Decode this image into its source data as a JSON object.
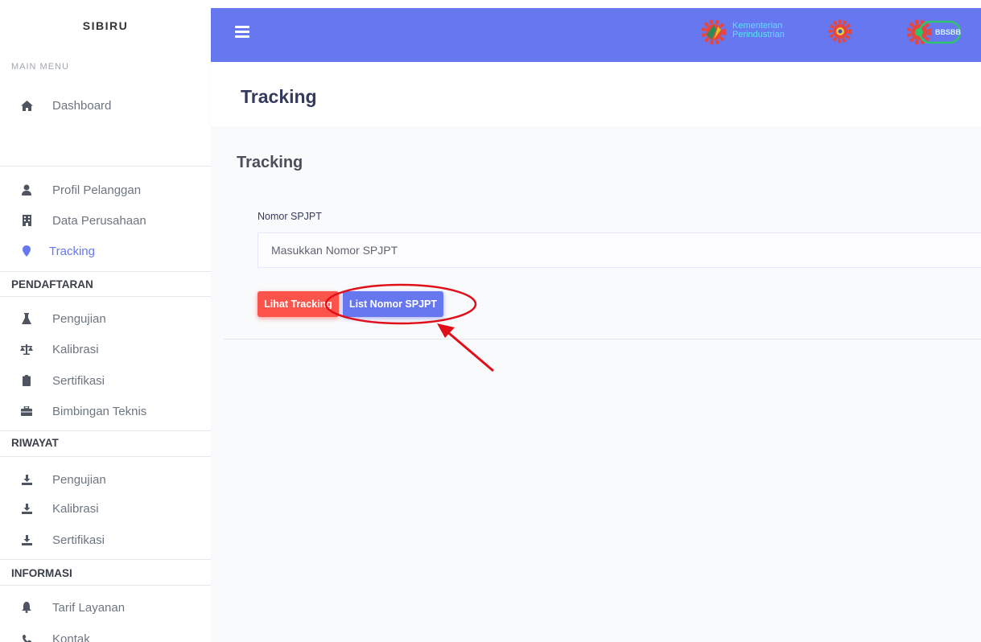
{
  "sidebar": {
    "brand": "SIBIRU",
    "main_menu_heading": "MAIN MENU",
    "dashboard": {
      "label": "Dashboard",
      "icon": "home-icon"
    },
    "items_top": [
      {
        "label": "Profil Pelanggan",
        "icon": "user-icon"
      },
      {
        "label": "Data Perusahaan",
        "icon": "building-icon"
      },
      {
        "label": "Tracking",
        "icon": "map-marker-icon",
        "active": true
      }
    ],
    "sections": [
      {
        "title": "PENDAFTARAN",
        "items": [
          {
            "label": "Pengujian",
            "icon": "flask-icon"
          },
          {
            "label": "Kalibrasi",
            "icon": "balance-scale-icon"
          },
          {
            "label": "Sertifikasi",
            "icon": "clipboard-icon"
          },
          {
            "label": "Bimbingan Teknis",
            "icon": "briefcase-icon"
          }
        ]
      },
      {
        "title": "RIWAYAT",
        "items": [
          {
            "label": "Pengujian",
            "icon": "download-icon"
          },
          {
            "label": "Kalibrasi",
            "icon": "download-icon"
          },
          {
            "label": "Sertifikasi",
            "icon": "download-icon"
          }
        ]
      },
      {
        "title": "INFORMASI",
        "items": [
          {
            "label": "Tarif Layanan",
            "icon": "bell-icon"
          },
          {
            "label": "Kontak",
            "icon": "phone-icon"
          }
        ]
      }
    ]
  },
  "topbar": {
    "logo_text": [
      "Kementerian",
      "Perindustrian"
    ],
    "bbsbb_text": "BBSBB",
    "color": "#6777ef"
  },
  "page": {
    "header_title": "Tracking",
    "card_title": "Tracking",
    "field_label": "Nomor SPJPT",
    "input_placeholder": "Masukkan Nomor SPJPT",
    "btn_lihat": "Lihat Tracking",
    "btn_list": "List Nomor SPJPT"
  },
  "colors": {
    "primary": "#6777ef",
    "danger": "#fc544b",
    "annotation": "#e0101a"
  }
}
